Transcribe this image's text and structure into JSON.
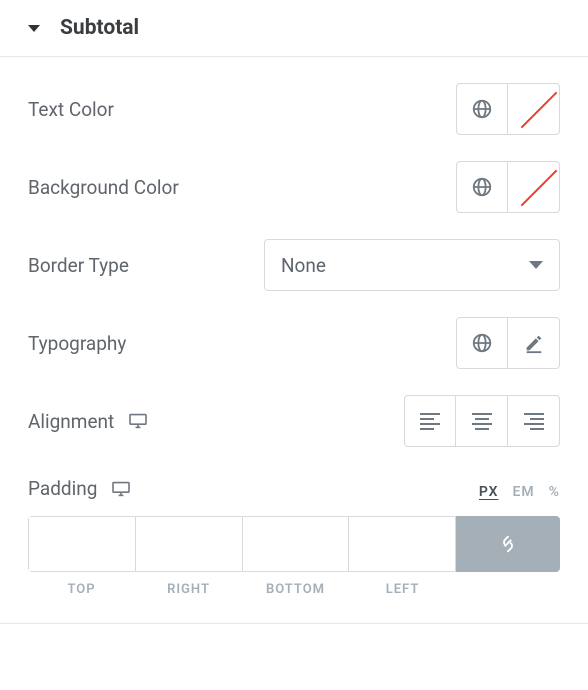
{
  "section": {
    "title": "Subtotal"
  },
  "labels": {
    "text_color": "Text Color",
    "background_color": "Background Color",
    "border_type": "Border Type",
    "typography": "Typography",
    "alignment": "Alignment",
    "padding": "Padding"
  },
  "border_type": {
    "value": "None"
  },
  "padding": {
    "top": "",
    "right": "",
    "bottom": "",
    "left": "",
    "labels": {
      "top": "TOP",
      "right": "RIGHT",
      "bottom": "BOTTOM",
      "left": "LEFT"
    },
    "units": {
      "px": "PX",
      "em": "EM",
      "pct": "%",
      "active": "px"
    }
  }
}
